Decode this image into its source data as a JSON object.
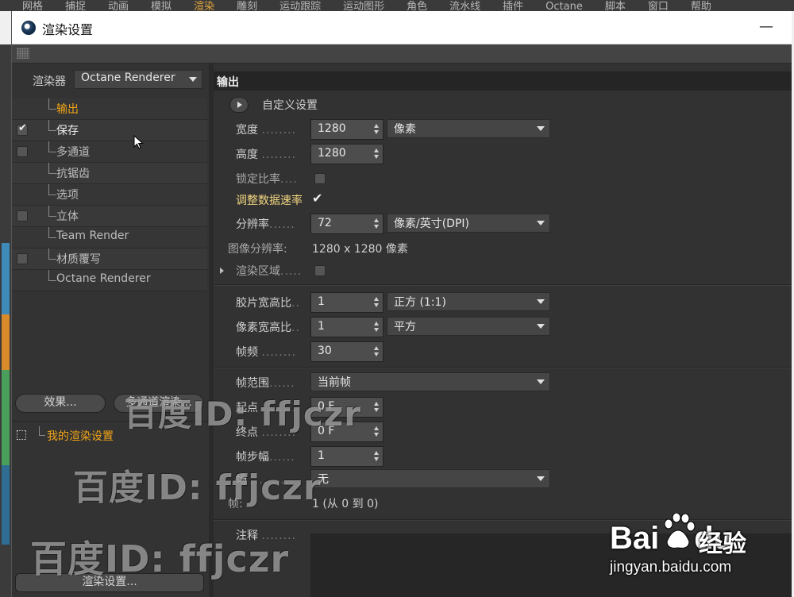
{
  "background_menu": [
    "网格",
    "捕捉",
    "动画",
    "模拟",
    "渲染",
    "雕刻",
    "运动跟踪",
    "运动图形",
    "角色",
    "流水线",
    "插件",
    "Octane",
    "脚本",
    "窗口",
    "帮助"
  ],
  "window": {
    "title": "渲染设置",
    "minimize_glyph": "—"
  },
  "left": {
    "renderer_label": "渲染器",
    "renderer_value": "Octane Renderer",
    "tree": [
      {
        "label": "输出",
        "check": "none"
      },
      {
        "label": "保存",
        "check": "on"
      },
      {
        "label": "多通道",
        "check": "off"
      },
      {
        "label": "抗锯齿",
        "check": "none"
      },
      {
        "label": "选项",
        "check": "none"
      },
      {
        "label": "立体",
        "check": "off"
      },
      {
        "label": "Team Render",
        "check": "none"
      },
      {
        "label": "材质覆写",
        "check": "off"
      },
      {
        "label": "Octane Renderer",
        "check": "none"
      }
    ],
    "effects_button": "效果...",
    "multipass_button": "多通道渲染...",
    "setting_item": "我的渲染设置",
    "render_settings_button": "渲染设置..."
  },
  "right": {
    "section_title": "输出",
    "preset_label": "自定义设置",
    "width": {
      "label": "宽度",
      "value": "1280",
      "unit": "像素"
    },
    "height": {
      "label": "高度",
      "value": "1280"
    },
    "lock_ratio": {
      "label": "锁定比率"
    },
    "adapt_data_rate": {
      "label": "调整数据速率"
    },
    "resolution": {
      "label": "分辨率",
      "value": "72",
      "unit": "像素/英寸(DPI)"
    },
    "image_resolution": {
      "label": "图像分辨率:",
      "value": "1280 x 1280 像素"
    },
    "render_region": {
      "label": "渲染区域"
    },
    "film_aspect": {
      "label": "胶片宽高比",
      "value": "1",
      "preset": "正方 (1:1)"
    },
    "pixel_aspect": {
      "label": "像素宽高比",
      "value": "1",
      "preset": "平方"
    },
    "fps": {
      "label": "帧频",
      "value": "30"
    },
    "frame_range": {
      "label": "帧范围",
      "value": "当前帧"
    },
    "start": {
      "label": "起点",
      "value": "0 F"
    },
    "end": {
      "label": "终点",
      "value": "0 F"
    },
    "frame_step": {
      "label": "帧步幅",
      "value": "1"
    },
    "field": {
      "label": "场",
      "value": "无"
    },
    "frames": {
      "label": "帧:",
      "value": "1 (从 0 到 0)"
    },
    "notes": {
      "label": "注释"
    }
  },
  "watermarks": [
    "百度ID: ffjczr",
    "百度ID: ffjczr",
    "百度ID: ffjczr"
  ],
  "baidu_logo": {
    "word_left": "Bai",
    "word_right": "du",
    "cn": "经验",
    "url": "jingyan.baidu.com"
  },
  "colors": {
    "active_orange": "#f2a516",
    "highlight_yellow": "#f2d680",
    "panel_bg": "#323232"
  }
}
